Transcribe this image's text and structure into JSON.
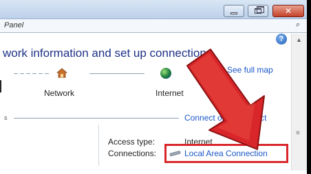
{
  "window": {
    "address_text": "Panel",
    "minimize_glyph": "–",
    "close_glyph": "✕",
    "search_glyph": "⌕"
  },
  "help_glyph": "?",
  "heading": "work information and set up connections",
  "map": {
    "see_full_map": "See full map",
    "network_label": "Network",
    "internet_label": "Internet"
  },
  "connect_link": "Connect or disconnect",
  "access_type_label": "Access type:",
  "access_type_value": "Internet",
  "connections_label": "Connections:",
  "connections_value": "Local Area Connection",
  "left_tab_mark": "s",
  "colors": {
    "heading": "#1e3287",
    "link": "#1a57c8",
    "highlight": "#d9262b",
    "arrow": "#d9262b"
  },
  "icons": [
    "house-icon",
    "globe-icon",
    "network-connection-icon",
    "help-icon",
    "search-icon"
  ]
}
